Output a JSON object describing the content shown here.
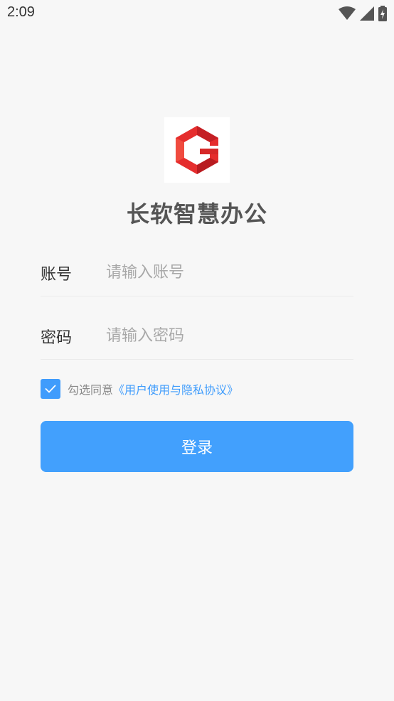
{
  "status_bar": {
    "time": "2:09",
    "icons": [
      "wifi-icon",
      "signal-icon",
      "battery-charging-icon"
    ]
  },
  "app": {
    "logo_icon": "red-g-logo-icon",
    "title": "长软智慧办公"
  },
  "form": {
    "account": {
      "label": "账号",
      "value": "",
      "placeholder": "请输入账号"
    },
    "password": {
      "label": "密码",
      "value": "",
      "placeholder": "请输入密码"
    }
  },
  "agreement": {
    "checked": true,
    "text": "勾选同意",
    "link_text": "《用户使用与隐私协议》"
  },
  "login_button": {
    "label": "登录"
  },
  "colors": {
    "accent": "#42a0fd",
    "link": "#3f9cfc",
    "logo_red": "#e52d2d",
    "background": "#f7f7f7"
  }
}
